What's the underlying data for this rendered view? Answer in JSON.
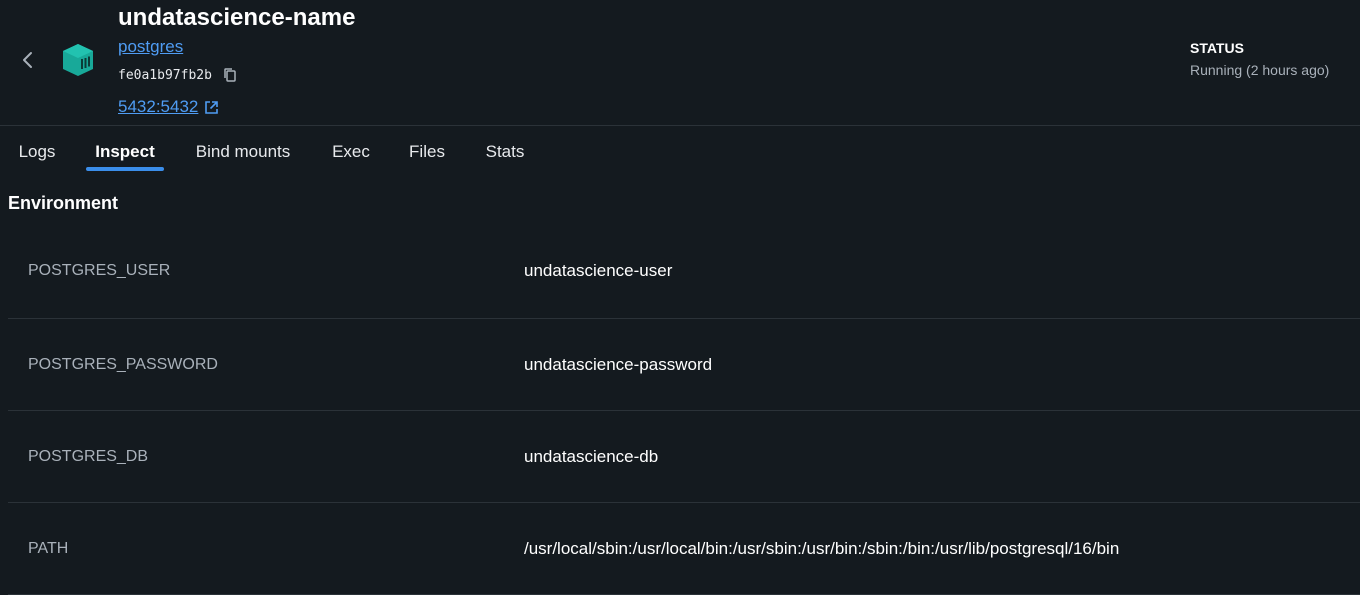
{
  "header": {
    "title": "undatascience-name",
    "image_link": "postgres",
    "container_id": "fe0a1b97fb2b",
    "port_mapping": "5432:5432",
    "status_label": "STATUS",
    "status_value": "Running (2 hours ago)",
    "icon_color": "#18a999"
  },
  "tabs": [
    {
      "label": "Logs",
      "active": false
    },
    {
      "label": "Inspect",
      "active": true
    },
    {
      "label": "Bind mounts",
      "active": false
    },
    {
      "label": "Exec",
      "active": false
    },
    {
      "label": "Files",
      "active": false
    },
    {
      "label": "Stats",
      "active": false
    }
  ],
  "section": {
    "title": "Environment"
  },
  "environment": [
    {
      "key": "POSTGRES_USER",
      "value": "undatascience-user"
    },
    {
      "key": "POSTGRES_PASSWORD",
      "value": "undatascience-password"
    },
    {
      "key": "POSTGRES_DB",
      "value": "undatascience-db"
    },
    {
      "key": "PATH",
      "value": "/usr/local/sbin:/usr/local/bin:/usr/sbin:/usr/bin:/sbin:/bin:/usr/lib/postgresql/16/bin"
    }
  ],
  "colors": {
    "background": "#141a1f",
    "accent": "#3b8eea",
    "link": "#4f9cf3",
    "divider": "#2b3238"
  },
  "icons": {
    "back": "chevron-left-icon",
    "container": "container-cube-icon",
    "copy": "copy-icon",
    "external": "external-link-icon"
  }
}
